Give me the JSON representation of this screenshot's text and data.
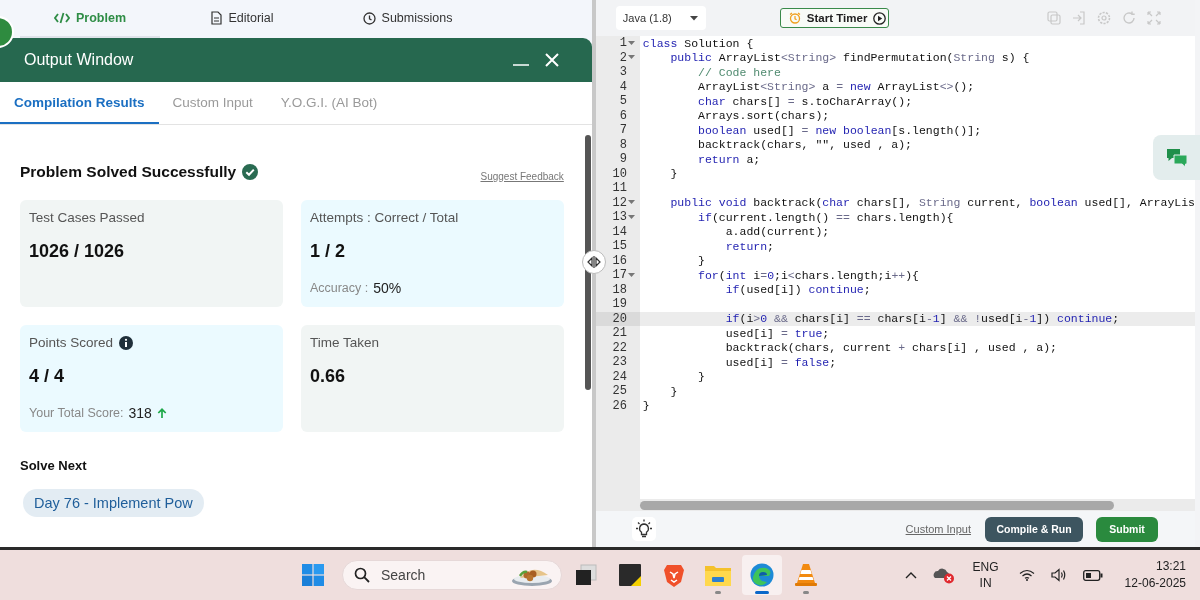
{
  "problem_tabs": [
    {
      "label": "Problem",
      "selected": true
    },
    {
      "label": "Editorial",
      "selected": false
    },
    {
      "label": "Submissions",
      "selected": false
    }
  ],
  "output_window": {
    "title": "Output Window",
    "tabs": [
      {
        "label": "Compilation Results",
        "selected": true
      },
      {
        "label": "Custom Input",
        "selected": false
      },
      {
        "label": "Y.O.G.I. (AI Bot)",
        "selected": false
      }
    ],
    "status": "Problem Solved Successfully",
    "solved": true,
    "feedback_link": "Suggest Feedback",
    "cards": [
      {
        "label": "Test Cases Passed",
        "value": "1026 / 1026",
        "color": "#f1f5f4",
        "info": false
      },
      {
        "label": "Attempts : Correct / Total",
        "value": "1 / 2",
        "note_label": "Accuracy :",
        "note_value": "50%",
        "color": "#ebfaff",
        "info": false,
        "rising": false
      },
      {
        "label": "Points Scored",
        "value": "4 / 4",
        "note_label": "Your Total Score:",
        "note_value": "318",
        "rising": true,
        "color": "#ebfaff",
        "info": true
      },
      {
        "label": "Time Taken",
        "value": "0.66",
        "color": "#f1f5f4",
        "info": false
      }
    ],
    "solve_next": {
      "heading": "Solve Next",
      "items": [
        "Day 76 - Implement Pow"
      ]
    }
  },
  "editor": {
    "language": "Java (1.8)",
    "timer_button": "Start Timer",
    "lines": [
      {
        "number": "1",
        "fold": true,
        "active": false,
        "parts": [
          {
            "kind": "keyword",
            "text": "class"
          },
          {
            "text": " Solution {"
          }
        ]
      },
      {
        "number": "2",
        "fold": true,
        "active": false,
        "parts": [
          {
            "kind": "keyword",
            "text": "    public"
          },
          {
            "text": " ArrayList"
          },
          {
            "kind": "type",
            "text": "<String>"
          },
          {
            "text": " findPermutation("
          },
          {
            "kind": "type",
            "text": "String"
          },
          {
            "text": " s) {"
          }
        ]
      },
      {
        "number": "3",
        "fold": false,
        "active": false,
        "parts": [
          {
            "kind": "comment",
            "text": "        // Code here"
          }
        ]
      },
      {
        "number": "4",
        "fold": false,
        "active": false,
        "parts": [
          {
            "text": "        ArrayList"
          },
          {
            "kind": "type",
            "text": "<String>"
          },
          {
            "text": " a "
          },
          {
            "kind": "type",
            "text": "="
          },
          {
            "kind": "keyword",
            "text": " new"
          },
          {
            "text": " ArrayList"
          },
          {
            "kind": "type",
            "text": "<>"
          },
          {
            "text": "();"
          }
        ]
      },
      {
        "number": "5",
        "fold": false,
        "active": false,
        "parts": [
          {
            "kind": "keyword",
            "text": "        char"
          },
          {
            "text": " chars[] "
          },
          {
            "kind": "type",
            "text": "="
          },
          {
            "text": " s.toCharArray();"
          }
        ]
      },
      {
        "number": "6",
        "fold": false,
        "active": false,
        "parts": [
          {
            "text": "        Arrays.sort(chars);"
          }
        ]
      },
      {
        "number": "7",
        "fold": false,
        "active": false,
        "parts": [
          {
            "kind": "keyword",
            "text": "        boolean"
          },
          {
            "text": " used[] "
          },
          {
            "kind": "type",
            "text": "="
          },
          {
            "kind": "keyword",
            "text": " new boolean"
          },
          {
            "text": "[s.length()];"
          }
        ]
      },
      {
        "number": "8",
        "fold": false,
        "active": false,
        "parts": [
          {
            "text": "        backtrack(chars, \"\", used , a);"
          }
        ]
      },
      {
        "number": "9",
        "fold": false,
        "active": false,
        "parts": [
          {
            "kind": "keyword",
            "text": "        return"
          },
          {
            "text": " a;"
          }
        ]
      },
      {
        "number": "10",
        "fold": false,
        "active": false,
        "parts": [
          {
            "text": "    }"
          }
        ]
      },
      {
        "number": "11",
        "fold": false,
        "active": false
      },
      {
        "number": "12",
        "fold": true,
        "active": false,
        "parts": [
          {
            "kind": "keyword",
            "text": "    public void"
          },
          {
            "text": " backtrack("
          },
          {
            "kind": "keyword",
            "text": "char"
          },
          {
            "text": " chars[], "
          },
          {
            "kind": "type",
            "text": "String"
          },
          {
            "text": " current, "
          },
          {
            "kind": "keyword",
            "text": "boolean"
          },
          {
            "text": " used[], ArrayLis"
          }
        ]
      },
      {
        "number": "13",
        "fold": true,
        "active": false,
        "parts": [
          {
            "kind": "keyword",
            "text": "        if"
          },
          {
            "text": "(current.length() "
          },
          {
            "kind": "type",
            "text": "=="
          },
          {
            "text": " chars.length){"
          }
        ]
      },
      {
        "number": "14",
        "fold": false,
        "active": false,
        "parts": [
          {
            "text": "            a.add(current);"
          }
        ]
      },
      {
        "number": "15",
        "fold": false,
        "active": false,
        "parts": [
          {
            "kind": "keyword",
            "text": "            return"
          },
          {
            "text": ";"
          }
        ]
      },
      {
        "number": "16",
        "fold": false,
        "active": false,
        "parts": [
          {
            "text": "        }"
          }
        ]
      },
      {
        "number": "17",
        "fold": true,
        "active": false,
        "parts": [
          {
            "kind": "keyword",
            "text": "        for"
          },
          {
            "text": "("
          },
          {
            "kind": "keyword",
            "text": "int"
          },
          {
            "text": " i"
          },
          {
            "kind": "type",
            "text": "="
          },
          {
            "kind": "keyword",
            "text": "0"
          },
          {
            "text": ";i"
          },
          {
            "kind": "type",
            "text": "<"
          },
          {
            "text": "chars.length;i"
          },
          {
            "kind": "type",
            "text": "++"
          },
          {
            "text": "){"
          }
        ]
      },
      {
        "number": "18",
        "fold": false,
        "active": false,
        "parts": [
          {
            "kind": "keyword",
            "text": "            if"
          },
          {
            "text": "(used[i]) "
          },
          {
            "kind": "keyword",
            "text": "continue"
          },
          {
            "text": ";"
          }
        ]
      },
      {
        "number": "19",
        "fold": false,
        "active": false
      },
      {
        "number": "20",
        "fold": false,
        "active": true,
        "parts": [
          {
            "kind": "keyword",
            "text": "            if"
          },
          {
            "text": "(i"
          },
          {
            "kind": "type",
            "text": ">"
          },
          {
            "kind": "keyword",
            "text": "0"
          },
          {
            "kind": "type",
            "text": " &&"
          },
          {
            "text": " chars[i] "
          },
          {
            "kind": "type",
            "text": "=="
          },
          {
            "text": " chars[i"
          },
          {
            "kind": "type",
            "text": "-"
          },
          {
            "kind": "keyword",
            "text": "1"
          },
          {
            "text": "] "
          },
          {
            "kind": "type",
            "text": "&& !"
          },
          {
            "text": "used[i"
          },
          {
            "kind": "type",
            "text": "-"
          },
          {
            "kind": "keyword",
            "text": "1"
          },
          {
            "text": "]) "
          },
          {
            "kind": "keyword",
            "text": "continue"
          },
          {
            "text": ";"
          }
        ]
      },
      {
        "number": "21",
        "fold": false,
        "active": false,
        "parts": [
          {
            "text": "            used[i] "
          },
          {
            "kind": "type",
            "text": "="
          },
          {
            "kind": "keyword",
            "text": " true"
          },
          {
            "text": ";"
          }
        ]
      },
      {
        "number": "22",
        "fold": false,
        "active": false,
        "parts": [
          {
            "text": "            backtrack(chars, current "
          },
          {
            "kind": "type",
            "text": "+"
          },
          {
            "text": " chars[i] , used , a);"
          }
        ]
      },
      {
        "number": "23",
        "fold": false,
        "active": false,
        "parts": [
          {
            "text": "            used[i] "
          },
          {
            "kind": "type",
            "text": "="
          },
          {
            "kind": "keyword",
            "text": " false"
          },
          {
            "text": ";"
          }
        ]
      },
      {
        "number": "24",
        "fold": false,
        "active": false,
        "parts": [
          {
            "text": "        }"
          }
        ]
      },
      {
        "number": "25",
        "fold": false,
        "active": false,
        "parts": [
          {
            "text": "    }"
          }
        ]
      },
      {
        "number": "26",
        "fold": false,
        "active": false,
        "parts": [
          {
            "text": "}"
          }
        ]
      }
    ],
    "custom_input_link": "Custom Input",
    "compile_button": "Compile & Run",
    "submit_button": "Submit"
  },
  "taskbar": {
    "search_placeholder": "Search",
    "apps": [
      {
        "kind": "taskview",
        "running": false,
        "selected": false
      },
      {
        "kind": "notes",
        "running": false,
        "selected": false
      },
      {
        "kind": "lion",
        "running": false,
        "selected": false
      },
      {
        "kind": "folder",
        "running": true,
        "selected": false
      },
      {
        "kind": "edge",
        "running": true,
        "selected": true
      },
      {
        "kind": "cone",
        "running": true,
        "selected": false
      }
    ],
    "language": "ENG",
    "region": "IN",
    "time": "13:21",
    "date": "12-06-2025"
  }
}
